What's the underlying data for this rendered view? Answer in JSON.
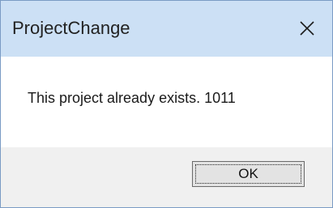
{
  "dialog": {
    "title": "ProjectChange",
    "message": "This project already exists. 1011",
    "ok_label": "OK"
  },
  "icons": {
    "close": "close-icon"
  },
  "colors": {
    "titlebar_bg": "#cce0f5",
    "footer_bg": "#f0f0f0",
    "border": "#7a9bc4"
  }
}
